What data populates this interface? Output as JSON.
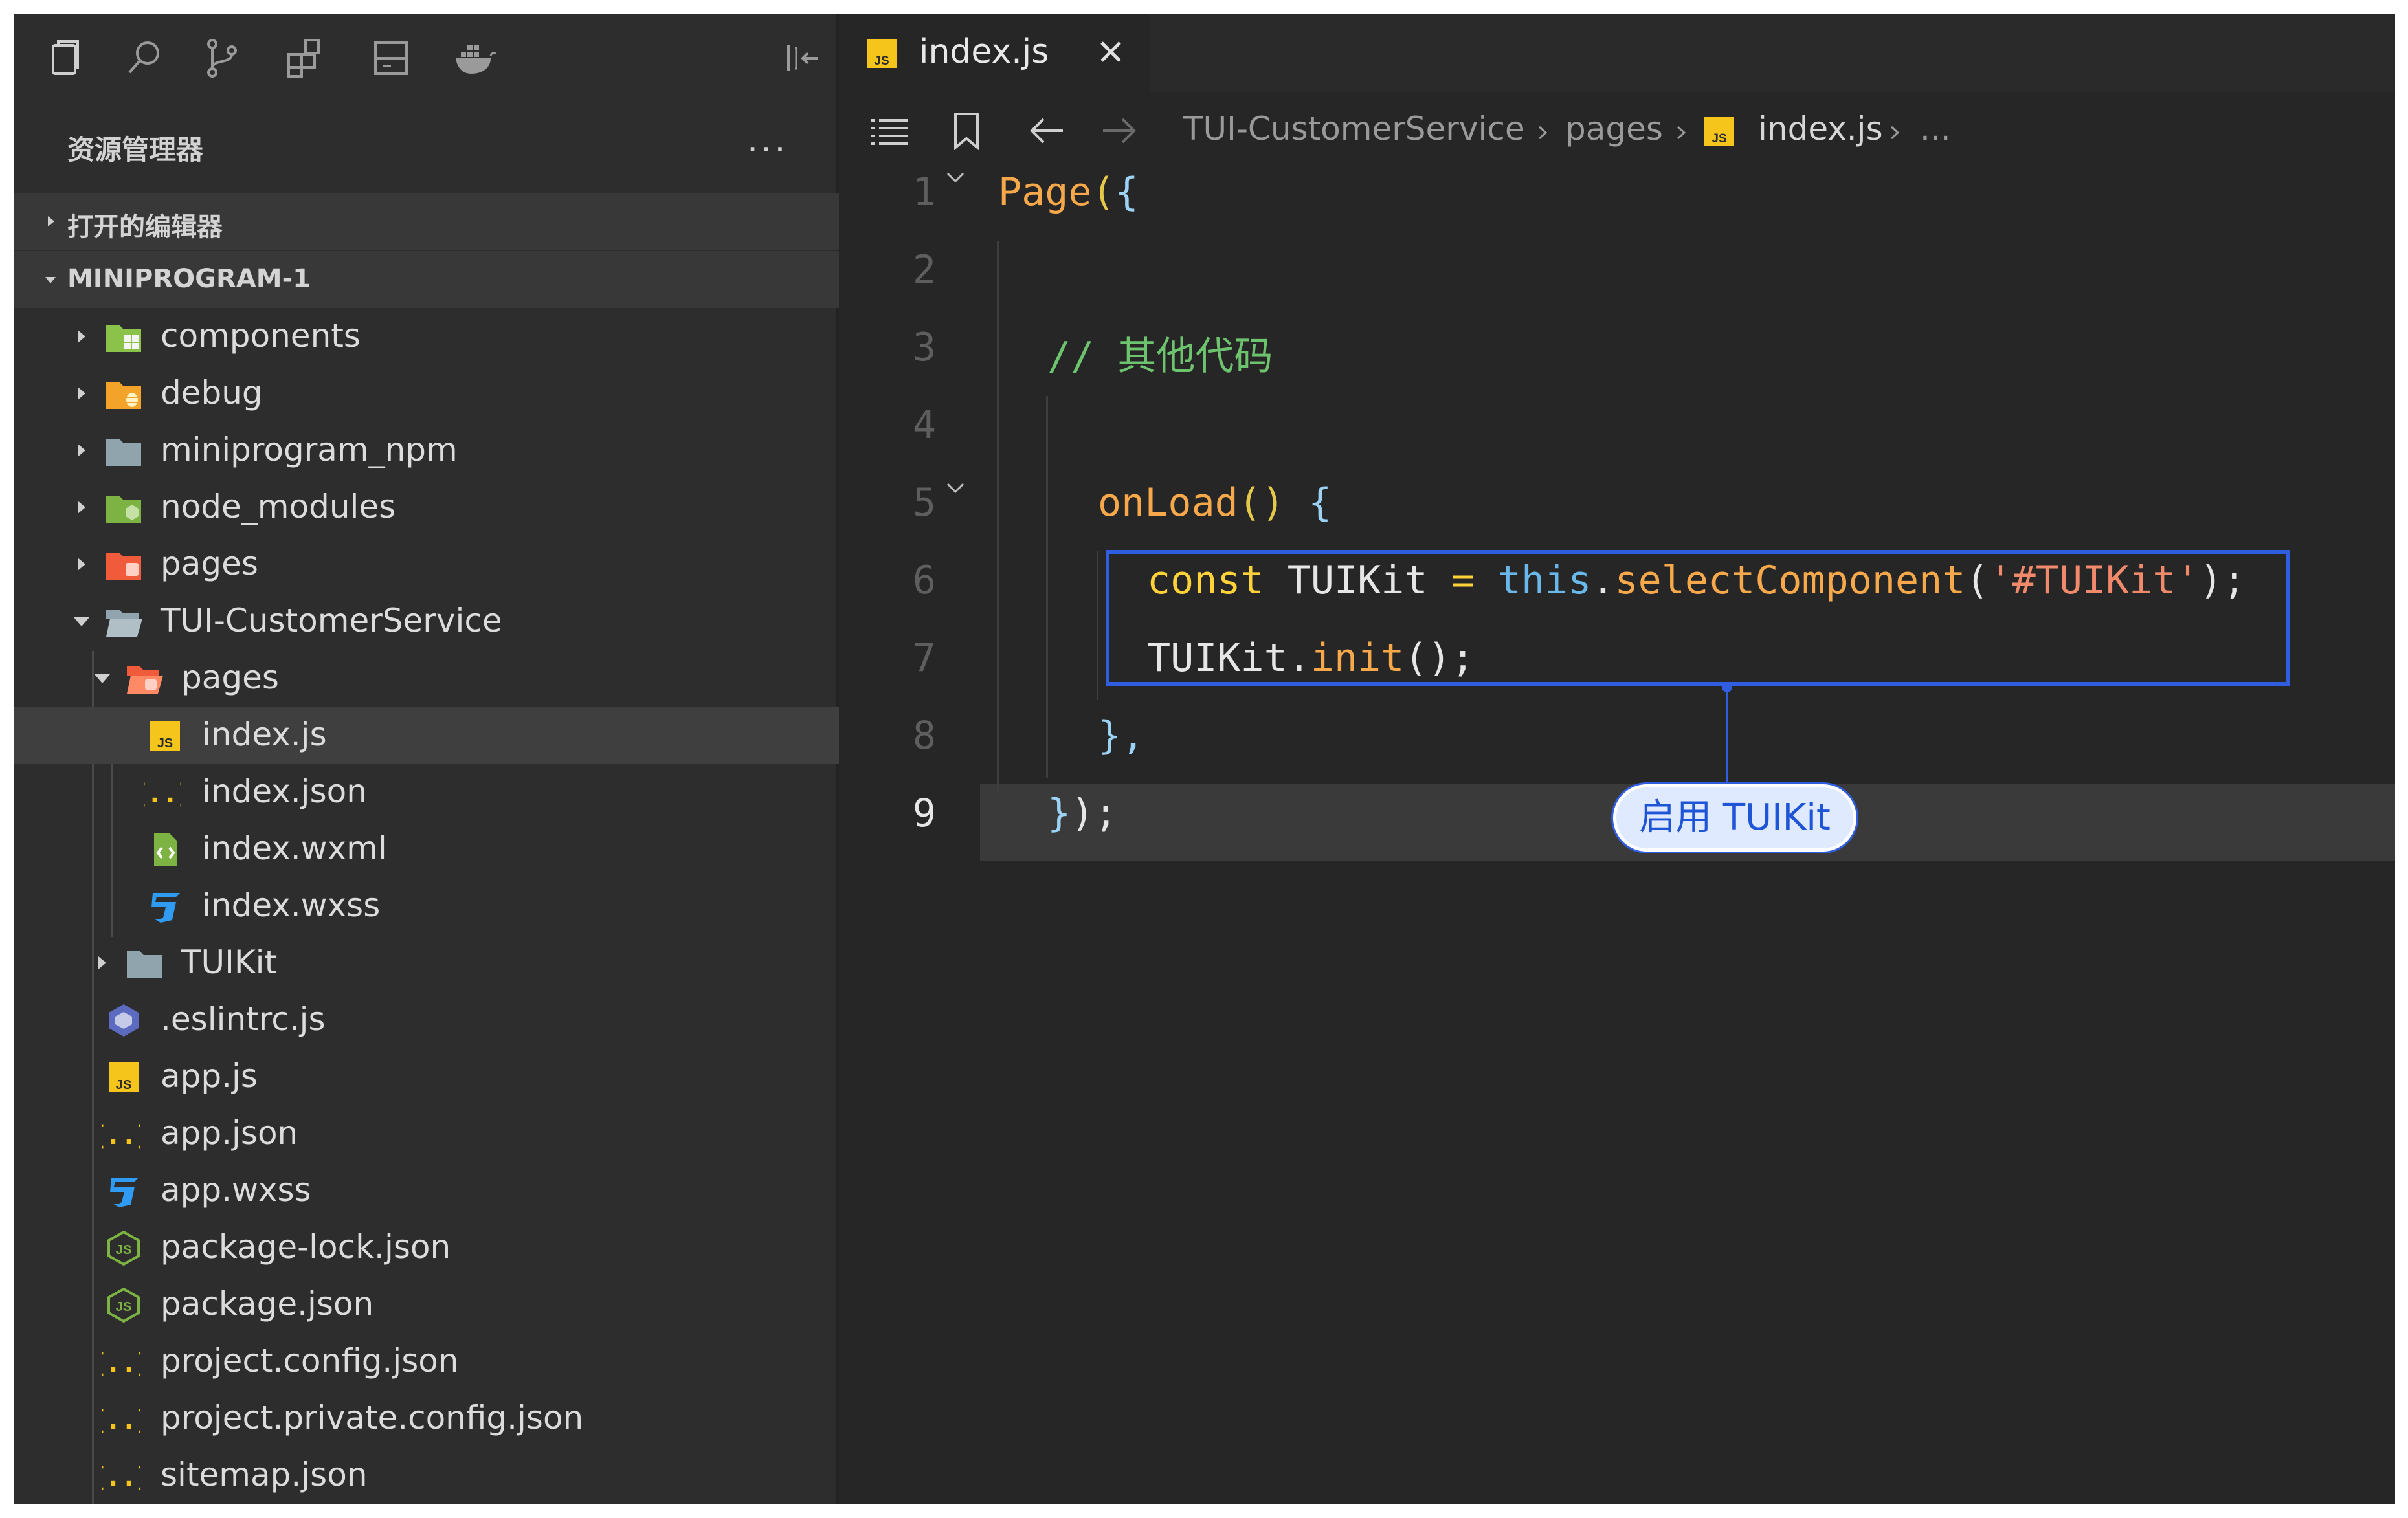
{
  "activity_bar": {
    "icons": [
      "files-icon",
      "search-icon",
      "source-control-icon",
      "extensions-icon",
      "storage-icon",
      "docker-icon",
      "collapse-panel-icon"
    ]
  },
  "explorer": {
    "title": "资源管理器",
    "more": "...",
    "open_editors": "打开的编辑器",
    "project": "MINIPROGRAM-1",
    "tree": [
      {
        "name": "components",
        "icon": "components-folder-icon",
        "expanded": false
      },
      {
        "name": "debug",
        "icon": "debug-folder-icon",
        "expanded": false
      },
      {
        "name": "miniprogram_npm",
        "icon": "folder-icon",
        "expanded": false
      },
      {
        "name": "node_modules",
        "icon": "node-modules-folder-icon",
        "expanded": false
      },
      {
        "name": "pages",
        "icon": "pages-folder-icon",
        "expanded": false
      },
      {
        "name": "TUI-CustomerService",
        "icon": "folder-open-icon",
        "expanded": true
      },
      {
        "name": "pages",
        "icon": "pages-folder-open-icon",
        "expanded": true
      },
      {
        "name": "index.js",
        "icon": "js-file-icon",
        "selected": true
      },
      {
        "name": "index.json",
        "icon": "json-file-icon"
      },
      {
        "name": "index.wxml",
        "icon": "wxml-file-icon"
      },
      {
        "name": "index.wxss",
        "icon": "wxss-file-icon"
      },
      {
        "name": "TUIKit",
        "icon": "folder-icon",
        "expanded": false
      },
      {
        "name": ".eslintrc.js",
        "icon": "eslint-file-icon"
      },
      {
        "name": "app.js",
        "icon": "js-file-icon"
      },
      {
        "name": "app.json",
        "icon": "json-file-icon"
      },
      {
        "name": "app.wxss",
        "icon": "wxss-file-icon"
      },
      {
        "name": "package-lock.json",
        "icon": "npm-json-icon"
      },
      {
        "name": "package.json",
        "icon": "npm-json-icon"
      },
      {
        "name": "project.config.json",
        "icon": "json-file-icon"
      },
      {
        "name": "project.private.config.json",
        "icon": "json-file-icon"
      },
      {
        "name": "sitemap.json",
        "icon": "json-file-icon"
      }
    ]
  },
  "tab": {
    "label": "index.js",
    "icon_text": "JS"
  },
  "breadcrumbs": {
    "items": [
      "TUI-CustomerService",
      "pages",
      "index.js",
      "..."
    ],
    "icon_text": "JS"
  },
  "editor": {
    "line_numbers": [
      "1",
      "2",
      "3",
      "4",
      "5",
      "6",
      "7",
      "8",
      "9"
    ],
    "active_line": "9",
    "lines": {
      "l1": {
        "fn": "Page",
        "paren": "(",
        "brace": "{"
      },
      "l3": {
        "comment": "// 其他代码"
      },
      "l5": {
        "fn": "onLoad",
        "parens": "()",
        "brace": "{"
      },
      "l6": {
        "kw": "const",
        "id": " TUIKit ",
        "op": "=",
        "this": " this",
        "dot": ".",
        "fn": "selectComponent",
        "paren_open": "(",
        "str": "'#TUIKit'",
        "paren_close": ");"
      },
      "l7": {
        "id": "TUIKit",
        "dot": ".",
        "fn": "init",
        "rest": "();"
      },
      "l8": {
        "text": "},"
      },
      "l9": {
        "brace": "}",
        "rest": ");"
      }
    }
  },
  "callout": {
    "label": "启用 TUIKit",
    "color": "#2f5fe0"
  }
}
